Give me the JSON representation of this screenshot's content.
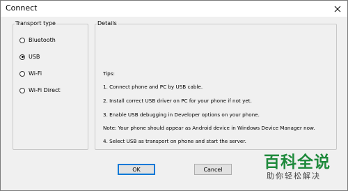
{
  "window": {
    "title": "Connect",
    "close_glyph": "✕"
  },
  "transport_group": {
    "legend": "Transport type",
    "options": [
      {
        "label": "Bluetooth",
        "checked": false
      },
      {
        "label": "USB",
        "checked": true
      },
      {
        "label": "Wi-Fi",
        "checked": false
      },
      {
        "label": "Wi-Fi Direct",
        "checked": false
      }
    ]
  },
  "details_group": {
    "legend": "Details",
    "tips": [
      "Tips:",
      "1. Connect phone and PC by USB cable.",
      "2. Install correct USB driver on PC for your phone if not yet.",
      "3. Enable USB debugging in Developer options on your phone.",
      "Note: Your phone should appear as Android device in Windows Device Manager now.",
      "4. Select USB as transport on phone and start the server."
    ]
  },
  "buttons": {
    "ok_label": "OK",
    "cancel_label": "Cancel"
  },
  "watermark": {
    "main": "百科全说",
    "sub": "助你轻松解决"
  },
  "colors": {
    "focus_border": "#0078d7",
    "watermark_green": "#1f8a3c"
  }
}
